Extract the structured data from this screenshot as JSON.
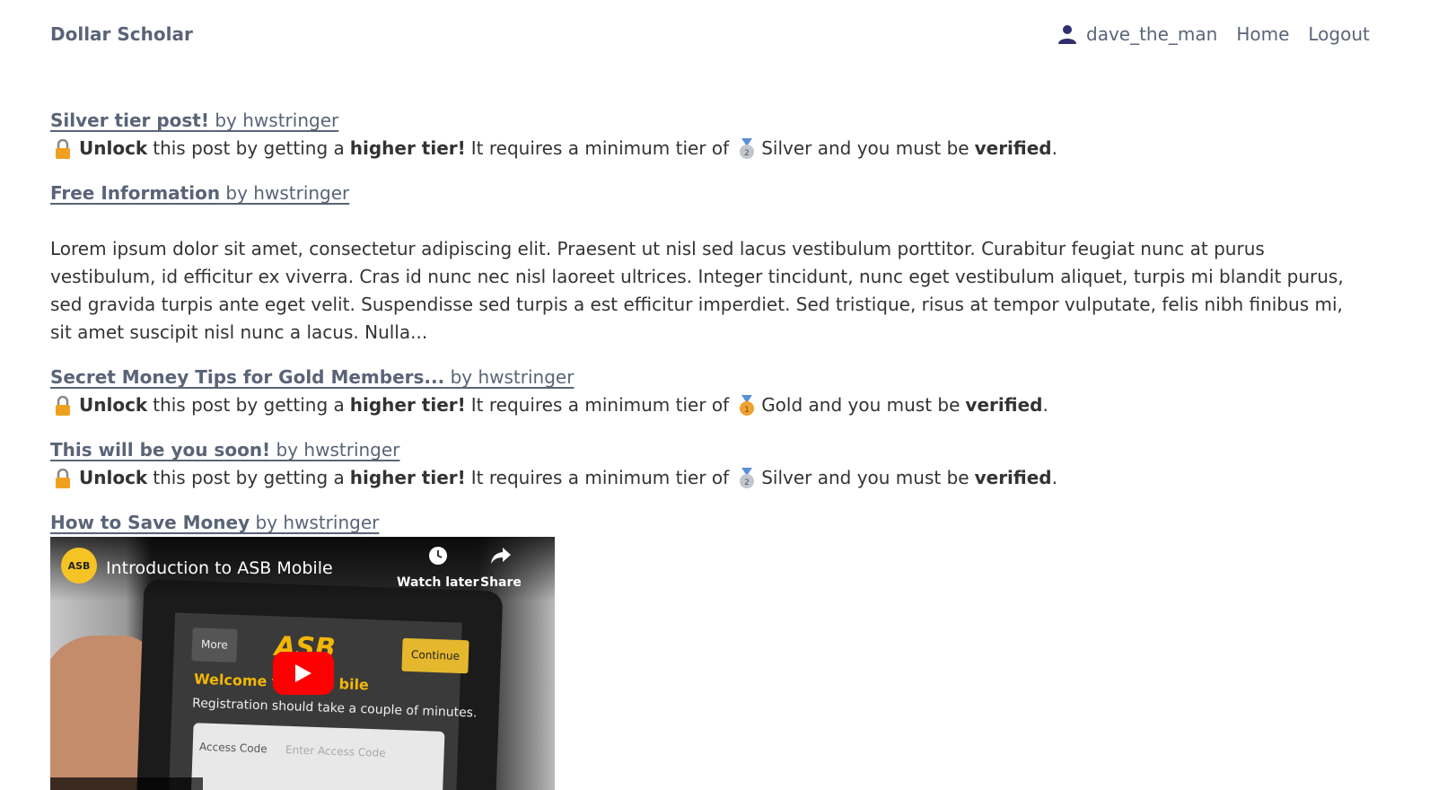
{
  "navbar": {
    "brand": "Dollar Scholar",
    "username": "dave_the_man",
    "home": "Home",
    "logout": "Logout"
  },
  "lock_text": {
    "unlock": "Unlock",
    "this_post": "this post by getting a",
    "higher_tier": "higher tier!",
    "requires": "It requires a minimum tier of",
    "must_be": "and you must be",
    "verified": "verified",
    "period": "."
  },
  "posts": [
    {
      "title": "Silver tier post!",
      "author": "by hwstringer",
      "tier": "Silver"
    },
    {
      "title": "Free Information",
      "author": "by hwstringer",
      "excerpt": "Lorem ipsum dolor sit amet, consectetur adipiscing elit. Praesent ut nisl sed lacus vestibulum porttitor. Curabitur feugiat nunc at purus vestibulum, id efficitur ex viverra. Cras id nunc nec nisl laoreet ultrices. Integer tincidunt, nunc eget vestibulum aliquet, turpis mi blandit purus, sed gravida turpis ante eget velit. Suspendisse sed turpis a est efficitur imperdiet. Sed tristique, risus at tempor vulputate, felis nibh finibus mi, sit amet suscipit nisl nunc a lacus. Nulla..."
    },
    {
      "title": "Secret Money Tips for Gold Members...",
      "author": "by hwstringer",
      "tier": "Gold"
    },
    {
      "title": "This will be you soon!",
      "author": "by hwstringer",
      "tier": "Silver"
    },
    {
      "title": "How to Save Money",
      "author": "by hwstringer"
    }
  ],
  "video": {
    "channel": "ASB",
    "title": "Introduction to ASB Mobile",
    "watch_later": "Watch later",
    "share": "Share",
    "screen_more": "More",
    "screen_logo": "ASB",
    "screen_continue": "Continue",
    "screen_welcome": "Welcome to",
    "screen_welcome_tail": "bile",
    "screen_registration": "Registration should take a couple of minutes.",
    "screen_access_code": "Access Code",
    "screen_access_placeholder": "Enter Access Code"
  },
  "colors": {
    "link": "#5a6478",
    "text": "#333333",
    "silver_medal": "#c0c6cc",
    "gold_medal": "#f0a030",
    "lock": "#f0a020"
  }
}
